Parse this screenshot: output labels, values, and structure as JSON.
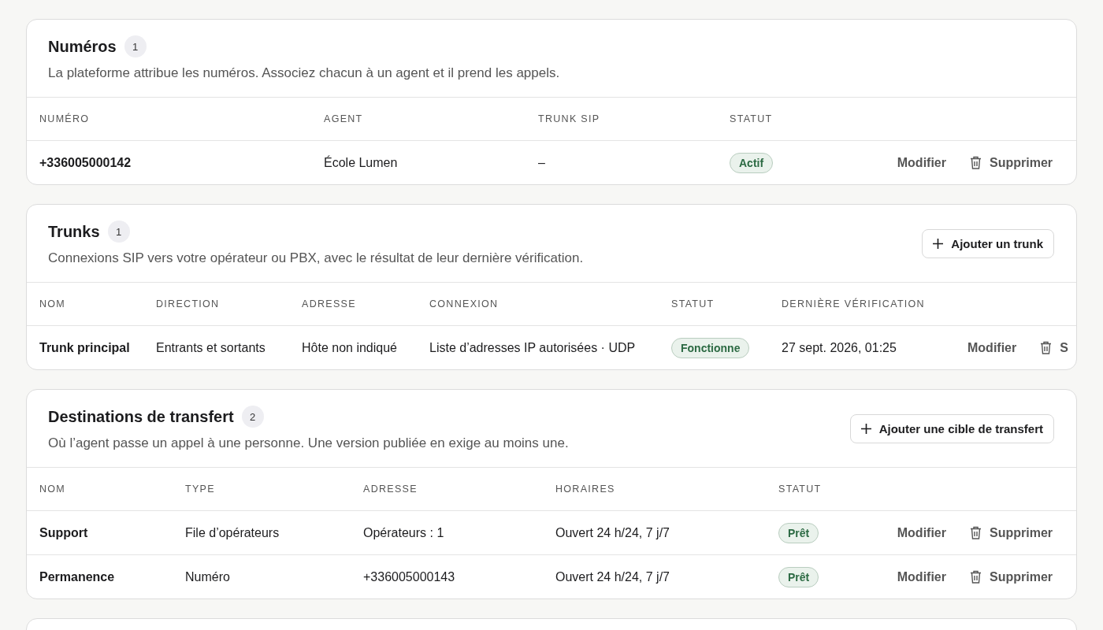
{
  "sections": [
    {
      "title": "Numéros",
      "count": "1",
      "description": "La plateforme attribue les numéros. Associez chacun à un agent et il prend les appels.",
      "columns": [
        "NUMÉRO",
        "AGENT",
        "TRUNK SIP",
        "STATUT"
      ],
      "rows": [
        {
          "cells": [
            {
              "kind": "strong",
              "text": "+336005000142"
            },
            {
              "kind": "text",
              "text": "École Lumen"
            },
            {
              "kind": "text",
              "text": "–"
            },
            {
              "kind": "badge",
              "text": "Actif"
            }
          ],
          "edit": "Modifier",
          "delete": "Supprimer"
        }
      ]
    },
    {
      "title": "Trunks",
      "count": "1",
      "description": "Connexions SIP vers votre opérateur ou PBX, avec le résultat de leur dernière vérification.",
      "add_button": "Ajouter un trunk",
      "columns": [
        "NOM",
        "DIRECTION",
        "ADRESSE",
        "CONNEXION",
        "STATUT",
        "DERNIÈRE VÉRIFICATION"
      ],
      "rows": [
        {
          "cells": [
            {
              "kind": "strong",
              "text": "Trunk principal"
            },
            {
              "kind": "text",
              "text": "Entrants et sortants"
            },
            {
              "kind": "text",
              "text": "Hôte non indiqué"
            },
            {
              "kind": "text",
              "text": "Liste d’adresses IP autorisées · UDP"
            },
            {
              "kind": "badge",
              "text": "Fonctionne"
            },
            {
              "kind": "text",
              "text": "27 sept. 2026, 01:25"
            }
          ],
          "edit": "Modifier",
          "delete": "S"
        }
      ]
    },
    {
      "title": "Destinations de transfert",
      "count": "2",
      "description": "Où l’agent passe un appel à une personne. Une version publiée en exige au moins une.",
      "add_button": "Ajouter une cible de transfert",
      "columns": [
        "NOM",
        "TYPE",
        "ADRESSE",
        "HORAIRES",
        "STATUT"
      ],
      "rows": [
        {
          "cells": [
            {
              "kind": "strong",
              "text": "Support"
            },
            {
              "kind": "text",
              "text": "File d’opérateurs"
            },
            {
              "kind": "text",
              "text": "Opérateurs : 1"
            },
            {
              "kind": "text",
              "text": "Ouvert 24 h/24, 7 j/7"
            },
            {
              "kind": "badge",
              "text": "Prêt"
            }
          ],
          "edit": "Modifier",
          "delete": "Supprimer"
        },
        {
          "cells": [
            {
              "kind": "strong",
              "text": "Permanence"
            },
            {
              "kind": "text",
              "text": "Numéro"
            },
            {
              "kind": "text",
              "text": "+336005000143"
            },
            {
              "kind": "text",
              "text": "Ouvert 24 h/24, 7 j/7"
            },
            {
              "kind": "badge",
              "text": "Prêt"
            }
          ],
          "edit": "Modifier",
          "delete": "Supprimer"
        }
      ]
    }
  ]
}
